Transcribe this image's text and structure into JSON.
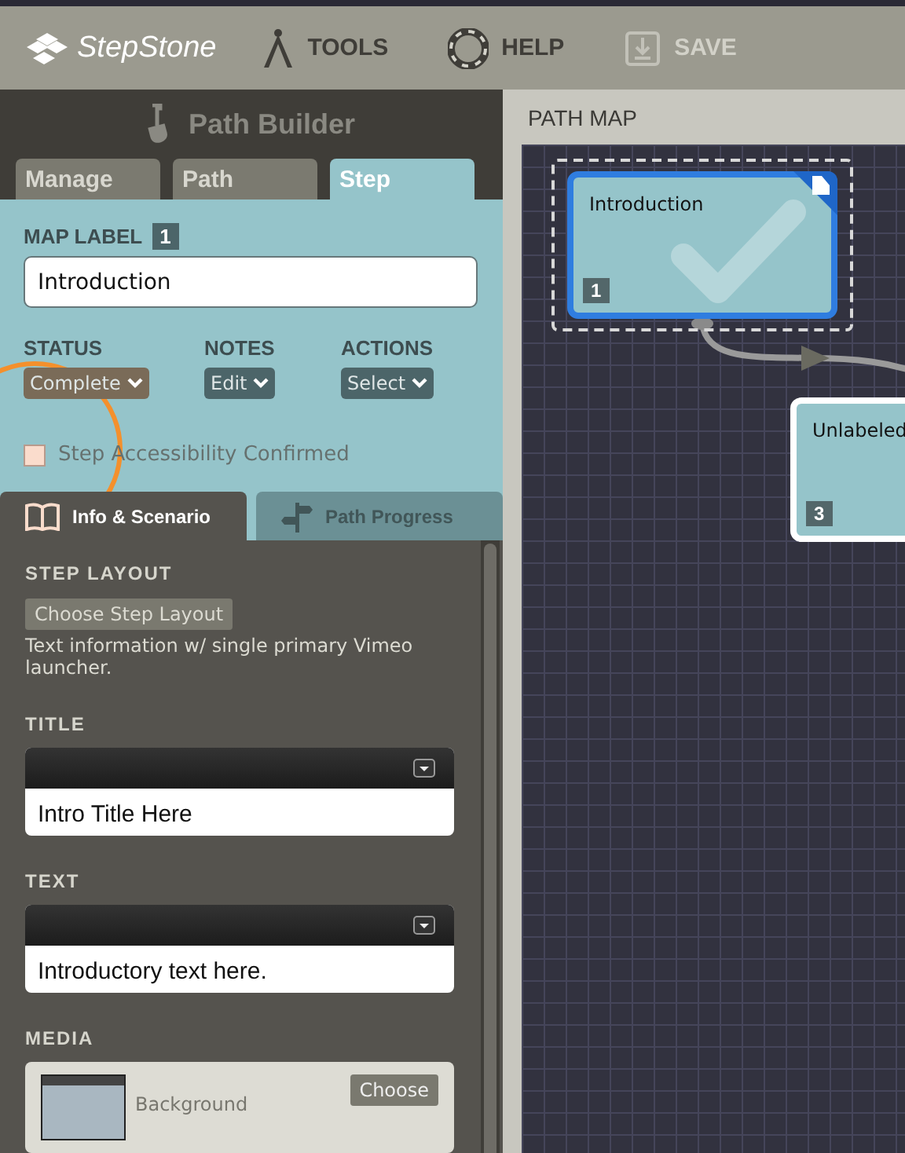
{
  "header": {
    "logo": "StepStone",
    "menu": [
      {
        "kind": "tools",
        "label": "TOOLS",
        "disabled": false
      },
      {
        "kind": "help",
        "label": "HELP",
        "disabled": false
      },
      {
        "kind": "save",
        "label": "SAVE",
        "disabled": true
      }
    ]
  },
  "panel": {
    "title": "Path Builder",
    "tabs": [
      {
        "label": "Manage",
        "selected": false
      },
      {
        "label": "Path",
        "selected": false
      },
      {
        "label": "Step",
        "selected": true
      }
    ],
    "map_label": {
      "label": "MAP LABEL",
      "badge": "1",
      "value": "Introduction"
    },
    "dropdowns": [
      {
        "label": "STATUS",
        "value": "Complete",
        "color": "#7a6b58"
      },
      {
        "label": "NOTES",
        "value": "Edit",
        "color": "#4c6569"
      },
      {
        "label": "ACTIONS",
        "value": "Select",
        "color": "#4c6569"
      }
    ],
    "accessibility": {
      "label": "Step Accessibility Confirmed",
      "checked": false
    },
    "subtabs": [
      {
        "kind": "book",
        "label": "Info & Scenario",
        "selected": true
      },
      {
        "kind": "signpost",
        "label": "Path Progress",
        "selected": false
      }
    ],
    "step_layout": {
      "heading": "STEP LAYOUT",
      "button": "Choose Step Layout",
      "description": "Text information w/ single primary Vimeo launcher."
    },
    "editors": [
      {
        "heading": "TITLE",
        "value": "Intro Title Here"
      },
      {
        "heading": "TEXT",
        "value": "Introductory text here."
      }
    ],
    "media": {
      "heading": "MEDIA",
      "label": "Background",
      "button": "Choose"
    }
  },
  "map": {
    "title": "PATH MAP",
    "nodes": [
      {
        "label": "Introduction",
        "number": "1",
        "selected": true,
        "complete": true,
        "note": true
      },
      {
        "label": "Unlabeled",
        "number": "3",
        "selected": false,
        "complete": false,
        "note": false
      }
    ]
  }
}
